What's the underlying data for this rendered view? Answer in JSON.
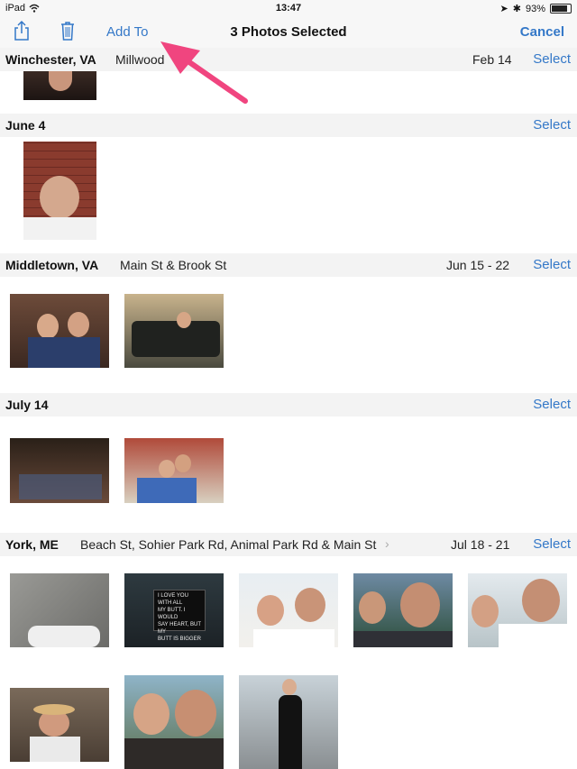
{
  "status": {
    "device": "iPad",
    "time": "13:47",
    "battery": "93%",
    "battery_level": 0.93
  },
  "nav": {
    "add_to_label": "Add To",
    "title": "3 Photos Selected",
    "cancel_label": "Cancel"
  },
  "sections": [
    {
      "location": "Winchester, VA",
      "address": "Millwood",
      "date": "Feb 14",
      "select": "Select"
    },
    {
      "location": "June 4",
      "address": "",
      "date": "",
      "select": "Select"
    },
    {
      "location": "Middletown, VA",
      "address": "Main St & Brook St",
      "date": "Jun 15 - 22",
      "select": "Select"
    },
    {
      "location": "July 14",
      "address": "",
      "date": "",
      "select": "Select"
    },
    {
      "location": "York, ME",
      "address": "Beach St, Sohier Park Rd, Animal Park Rd & Main St",
      "date": "Jul 18 - 21",
      "select": "Select"
    }
  ],
  "colors": {
    "accent": "#3478c8",
    "annotation_arrow": "#f0457f"
  },
  "photo_text": {
    "sign_lines": [
      "I LOVE YOU WITH ALL",
      "MY BUTT. I WOULD",
      "SAY HEART, BUT MY",
      "BUTT IS BIGGER"
    ]
  }
}
